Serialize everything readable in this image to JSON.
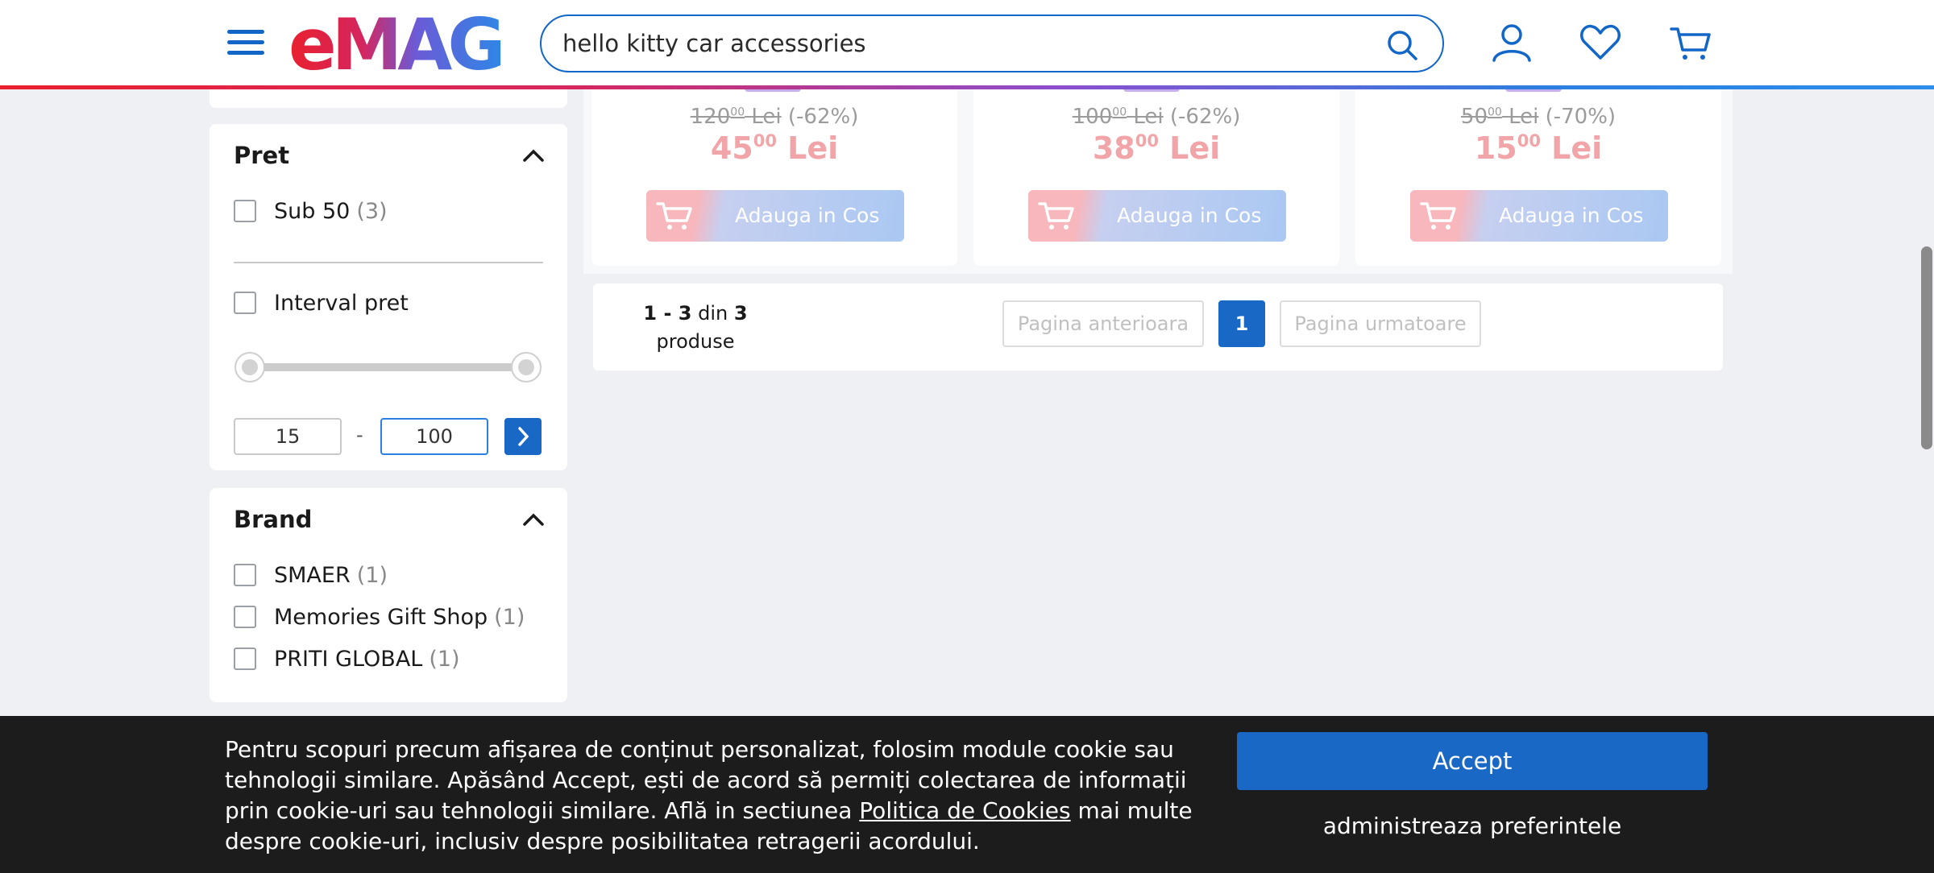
{
  "header": {
    "logo_text": "eMAG",
    "search_value": "hello kitty car accessories",
    "icons": [
      "menu-icon",
      "search-icon",
      "user-icon",
      "heart-icon",
      "cart-icon"
    ]
  },
  "filters": {
    "price": {
      "title": "Pret",
      "options": [
        {
          "label": "Sub 50",
          "count": "(3)"
        }
      ],
      "interval_label": "Interval pret",
      "min_value": "15",
      "max_value": "100",
      "dash": "-"
    },
    "brand": {
      "title": "Brand",
      "options": [
        {
          "label": "SMAER",
          "count": "(1)"
        },
        {
          "label": "Memories Gift Shop",
          "count": "(1)"
        },
        {
          "label": "PRITI GLOBAL",
          "count": "(1)"
        }
      ]
    }
  },
  "products": [
    {
      "old_int": "120",
      "old_dec": "00",
      "currency": "Lei",
      "discount": "(-62%)",
      "new_int": "45",
      "new_dec": "00",
      "button": "Adauga in Cos"
    },
    {
      "old_int": "100",
      "old_dec": "00",
      "currency": "Lei",
      "discount": "(-62%)",
      "new_int": "38",
      "new_dec": "00",
      "button": "Adauga in Cos"
    },
    {
      "old_int": "50",
      "old_dec": "00",
      "currency": "Lei",
      "discount": "(-70%)",
      "new_int": "15",
      "new_dec": "00",
      "button": "Adauga in Cos"
    }
  ],
  "pagination": {
    "range": "1 - 3",
    "of_word": "din",
    "total": "3",
    "unit": "produse",
    "prev": "Pagina anterioara",
    "current": "1",
    "next": "Pagina urmatoare"
  },
  "cookie": {
    "text_before": "Pentru scopuri precum afișarea de conținut personalizat, folosim module cookie sau tehnologii similare. Apăsând Accept, ești de acord să permiți colectarea de informații prin cookie-uri sau tehnologii similare. Află in sectiunea ",
    "link": "Politica de Cookies",
    "text_after": " mai multe despre cookie-uri, inclusiv despre posibilitatea retragerii acordului.",
    "accept": "Accept",
    "preferences": "administreaza preferintele"
  },
  "colors": {
    "brand_blue": "#1266c7",
    "logo_red": "#e9202e",
    "price_pink": "#f2a5a8",
    "banner_bg": "#1c1c1c"
  }
}
